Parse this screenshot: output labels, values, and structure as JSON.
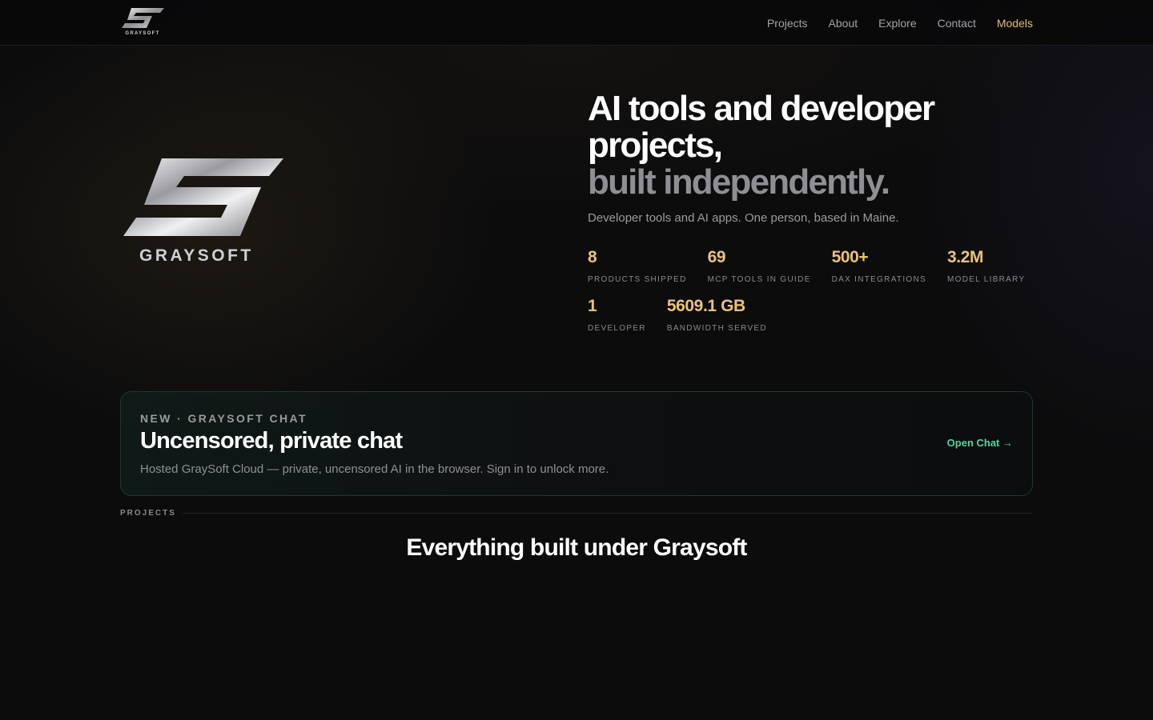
{
  "brand": {
    "name": "GRAYSOFT"
  },
  "nav": {
    "links": [
      "Projects",
      "About",
      "Explore",
      "Contact",
      "Models"
    ],
    "active": "Models",
    "active_color": "#e2bd74"
  },
  "hero": {
    "title_line1": "AI tools and developer projects,",
    "title_line2": "built independently.",
    "subtitle": "Developer tools and AI apps. One person, based in Maine.",
    "stats": [
      {
        "value": "8",
        "label": "Products shipped"
      },
      {
        "value": "69",
        "label": "MCP tools in guide"
      },
      {
        "value": "500+",
        "label": "DAX integrations"
      },
      {
        "value": "3.2M",
        "label": "Model library"
      },
      {
        "value": "1",
        "label": "Developer"
      },
      {
        "value": "5609.1 GB",
        "label": "Bandwidth served"
      }
    ],
    "stat_color": "#e9c27a"
  },
  "chat_card": {
    "eyebrow": "NEW · GRAYSOFT CHAT",
    "title": "Uncensored, private chat",
    "description": "Hosted GraySoft Cloud — private, uncensored AI in the browser. Sign in to unlock more.",
    "cta": "Open Chat →",
    "accent": "#54d6a0"
  },
  "projects": {
    "label": "PROJECTS",
    "title": "Everything built under Graysoft"
  }
}
